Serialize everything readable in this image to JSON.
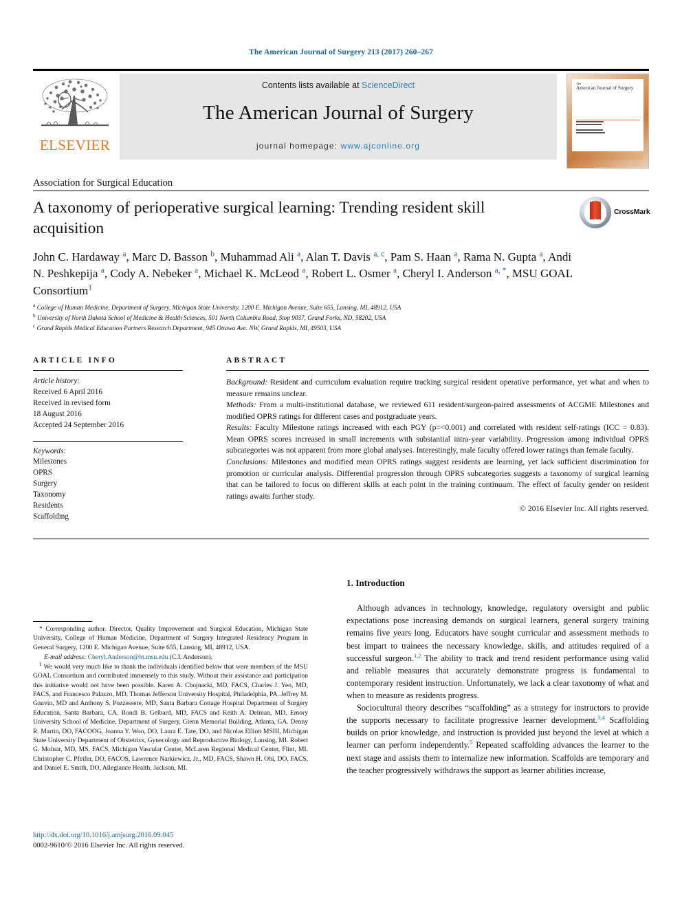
{
  "running_head": "The American Journal of Surgery 213 (2017) 260–267",
  "masthead": {
    "contents_prefix": "Contents lists available at ",
    "contents_link": "ScienceDirect",
    "journal_title": "The American Journal of Surgery",
    "homepage_prefix": "journal homepage: ",
    "homepage_url": "www.ajconline.org",
    "publisher_logo_text": "ELSEVIER",
    "cover_title_the": "The",
    "cover_title_main": "American Journal of Surgery"
  },
  "article": {
    "society": "Association for Surgical Education",
    "title": "A taxonomy of perioperative surgical learning: Trending resident skill acquisition",
    "crossmark_label": "CrossMark",
    "authors_html": "John C. Hardaway <sup>a</sup>, Marc D. Basson <sup>b</sup>, Muhammad Ali <sup>a</sup>, Alan T. Davis <sup>a, c</sup>, Pam S. Haan <sup>a</sup>, Rama N. Gupta <sup>a</sup>, Andi N. Peshkepija <sup>a</sup>, Cody A. Nebeker <sup>a</sup>, Michael K. McLeod <sup>a</sup>, Robert L. Osmer <sup>a</sup>, Cheryl I. Anderson <sup>a, <span class=\"star\">*</span></sup>, MSU GOAL Consortium<sup>1</sup>",
    "affiliations": [
      {
        "marker": "a",
        "text": "College of Human Medicine, Department of Surgery, Michigan State University, 1200 E. Michigan Avenue, Suite 655, Lansing, MI, 48912, USA"
      },
      {
        "marker": "b",
        "text": "University of North Dakota School of Medicine & Health Sciences, 501 North Columbia Road, Stop 9037, Grand Forks, ND, 58202, USA"
      },
      {
        "marker": "c",
        "text": "Grand Rapids Medical Education Partners Research Department, 945 Ottawa Ave. NW, Grand Rapids, MI, 49503, USA"
      }
    ]
  },
  "article_info": {
    "heading": "ARTICLE INFO",
    "history_label": "Article history:",
    "history_lines": [
      "Received 6 April 2016",
      "Received in revised form",
      "18 August 2016",
      "Accepted 24 September 2016"
    ],
    "keywords_label": "Keywords:",
    "keywords": [
      "Milestones",
      "OPRS",
      "Surgery",
      "Taxonomy",
      "Residents",
      "Scaffolding"
    ]
  },
  "abstract": {
    "heading": "ABSTRACT",
    "sections": [
      {
        "label": "Background:",
        "text": " Resident and curriculum evaluation require tracking surgical resident operative performance, yet what and when to measure remains unclear."
      },
      {
        "label": "Methods:",
        "text": " From a multi-institutional database, we reviewed 611 resident/surgeon-paired assessments of ACGME Milestones and modified OPRS ratings for different cases and postgraduate years."
      },
      {
        "label": "Results:",
        "text": " Faculty Milestone ratings increased with each PGY (p=<0.001) and correlated with resident self-ratings (ICC = 0.83). Mean OPRS scores increased in small increments with substantial intra-year variability. Progression among individual OPRS subcategories was not apparent from more global analyses. Interestingly, male faculty offered lower ratings than female faculty."
      },
      {
        "label": "Conclusions:",
        "text": " Milestones and modified mean OPRS ratings suggest residents are learning, yet lack sufficient discrimination for promotion or curricular analysis. Differential progression through OPRS subcategories suggests a taxonomy of surgical learning that can be tailored to focus on different skills at each point in the training continuum. The effect of faculty gender on resident ratings awaits further study."
      }
    ],
    "copyright": "© 2016 Elsevier Inc. All rights reserved."
  },
  "footnotes": {
    "corresponding": "* Corresponding author. Director, Quality Improvement and Surgical Education, Michigan State University, College of Human Medicine, Department of Surgery Integrated Residency Program in General Surgery, 1200 E. Michigan Avenue, Suite 655, Lansing, MI, 48912, USA.",
    "email_label": "E-mail address:",
    "email": "Cheryl.Anderson@ht.msu.edu",
    "email_suffix": "(C.I. Anderson).",
    "note1_marker": "1",
    "note1": "We would very much like to thank the individuals identified below that were members of the MSU GOAL Consortium and contributed immensely to this study. Without their assistance and participation this initiative would not have been possible. Karen A. Chojnacki, MD, FACS, Charles J. Yeo, MD, FACS, and Francesco Palazzo, MD, Thomas Jefferson University Hospital, Philadelphia, PA. Jeffrey M. Gauvin, MD and Anthony S. Pozzessere, MD, Santa Barbara Cottage Hospital Department of Surgery Education, Santa Barbara, CA. Rondi B. Gelbard, MD, FACS and Keith A. Delman, MD, Emory University School of Medicine, Department of Surgery, Glenn Memorial Building, Atlanta, GA. Denny R. Martin, DO, FACOOG, Joanna Y. Woo, DO, Laura E. Tate, DO, and Nicolas Elliott MSIII, Michigan State University Department of Obstetrics, Gynecology and Reproductive Biology, Lansing, MI. Robert G. Molnar, MD, MS, FACS, Michigan Vascular Center, McLaren Regional Medical Center, Flint, MI. Christopher C. Pfeifer, DO, FACOS, Lawrence Narkiewicz, Jr., MD, FACS, Shawn H. Obi, DO, FACS, and Daniel E. Smith, DO, Allegiance Health, Jackson, MI."
  },
  "doi_block": {
    "doi": "http://dx.doi.org/10.1016/j.amjsurg.2016.09.045",
    "issn": "0002-9610/© 2016 Elsevier Inc. All rights reserved."
  },
  "introduction": {
    "heading": "1. Introduction",
    "paragraphs": [
      "Although advances in technology, knowledge, regulatory oversight and public expectations pose increasing demands on surgical learners, general surgery training remains five years long. Educators have sought curricular and assessment methods to best impart to trainees the necessary knowledge, skills, and attitudes required of a successful surgeon.<sup>1,2</sup> The ability to track and trend resident performance using valid and reliable measures that accurately demonstrate progress is fundamental to contemporary resident instruction. Unfortunately, we lack a clear taxonomy of what and when to measure as residents progress.",
      "Sociocultural theory describes “scaffolding” as a strategy for instructors to provide the supports necessary to facilitate progressive learner development.<sup>3,4</sup> Scaffolding builds on prior knowledge, and instruction is provided just beyond the level at which a learner can perform independently.<sup>5</sup> Repeated scaffolding advances the learner to the next stage and assists them to internalize new information. Scaffolds are temporary and the teacher progressively withdraws the support as learner abilities increase,"
    ]
  },
  "colors": {
    "link_blue": "#1a6496",
    "sciencedirect_blue": "#2a7fbd",
    "elsevier_orange": "#E87722",
    "band_gray": "#e6e6e6"
  }
}
